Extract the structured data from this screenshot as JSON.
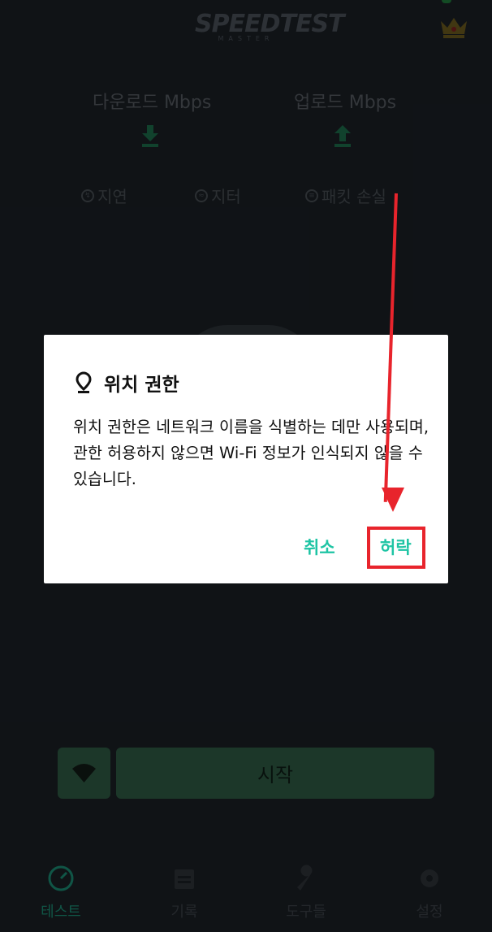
{
  "header": {
    "logo_text": "SPEEDTEST",
    "logo_subtext": "MASTER",
    "crown_icon": "crown-icon"
  },
  "metrics": {
    "download_label": "다운로드 Mbps",
    "upload_label": "업로드 Mbps",
    "latency_label": "지연",
    "jitter_label": "지터",
    "packet_loss_label": "패킷 손실"
  },
  "controls": {
    "wifi_icon": "wifi-icon",
    "start_label": "시작"
  },
  "tabs": [
    {
      "label": "테스트",
      "icon": "speedometer-icon",
      "active": true
    },
    {
      "label": "기록",
      "icon": "calendar-icon",
      "active": false
    },
    {
      "label": "도구들",
      "icon": "wrench-icon",
      "active": false
    },
    {
      "label": "설정",
      "icon": "gear-icon",
      "active": false
    }
  ],
  "dialog": {
    "title": "위치 권한",
    "message": "위치 권한은 네트워크 이름을 식별하는 데만 사용되며, 관한 허용하지 않으면 Wi-Fi 정보가 인식되지 않을 수 있습니다.",
    "cancel_label": "취소",
    "allow_label": "허락"
  },
  "colors": {
    "accent": "#1ec4a4",
    "annotation": "#e8242c",
    "button_green": "#2e5a43"
  }
}
